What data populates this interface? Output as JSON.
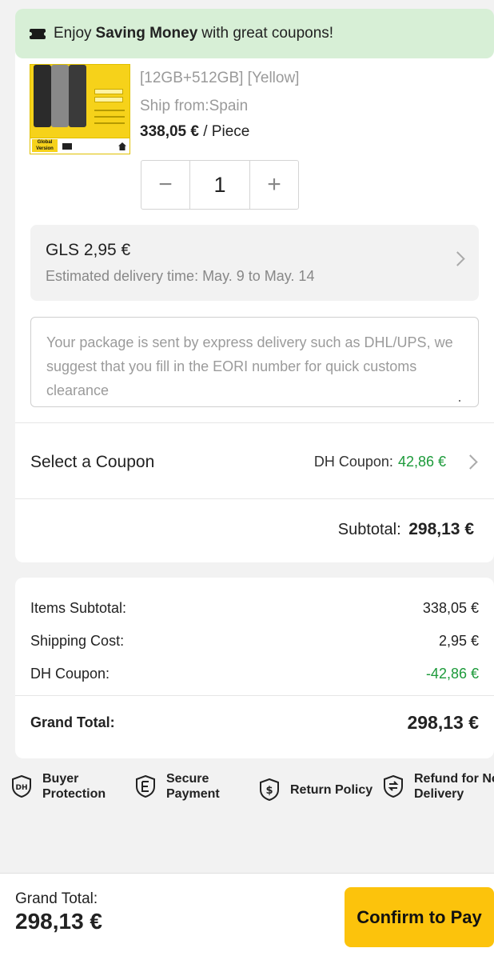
{
  "banner": {
    "prefix": "Enjoy",
    "highlight": "Saving Money",
    "suffix": "with great coupons!",
    "icon": "ticket-icon"
  },
  "product": {
    "image_label": "Global Version",
    "spec": "[12GB+512GB] [Yellow]",
    "ship_from": "Ship from:Spain",
    "price": "338,05 €",
    "price_unit": " / Piece"
  },
  "quantity": {
    "minus": "−",
    "value": "1",
    "plus": "+"
  },
  "shipping": {
    "method": "GLS 2,95 €",
    "eta": "Estimated delivery time: May. 9 to May. 14"
  },
  "eori": {
    "placeholder": "Your package is sent by express delivery such as DHL/UPS, we suggest that you fill in the EORI number for quick customs clearance"
  },
  "coupon": {
    "label": "Select a Coupon",
    "name": "DH Coupon:",
    "amount": "42,86 €"
  },
  "subtotal": {
    "label": "Subtotal:",
    "value": "298,13 €"
  },
  "summary": {
    "items_label": "Items Subtotal:",
    "items_value": "338,05 €",
    "shipping_label": "Shipping Cost:",
    "shipping_value": "2,95 €",
    "coupon_label": "DH Coupon:",
    "coupon_value": "-42,86 €",
    "grand_label": "Grand Total:",
    "grand_value": "298,13 €"
  },
  "trust": [
    {
      "line1": "Buyer",
      "line2": "Protection",
      "icon": "dh-shield-icon"
    },
    {
      "line1": "Secure",
      "line2": "Payment",
      "icon": "e-shield-icon"
    },
    {
      "line1": "Return Policy",
      "line2": "",
      "icon": "dollar-shield-icon"
    },
    {
      "line1": "Refund for No",
      "line2": "Delivery",
      "icon": "refund-shield-icon"
    }
  ],
  "footer": {
    "grand_label": "Grand Total:",
    "grand_value": "298,13 €",
    "confirm": "Confirm to Pay"
  },
  "colors": {
    "accent": "#fcc30c",
    "green": "#1c9a3a",
    "banner_bg": "#d7efd6"
  }
}
